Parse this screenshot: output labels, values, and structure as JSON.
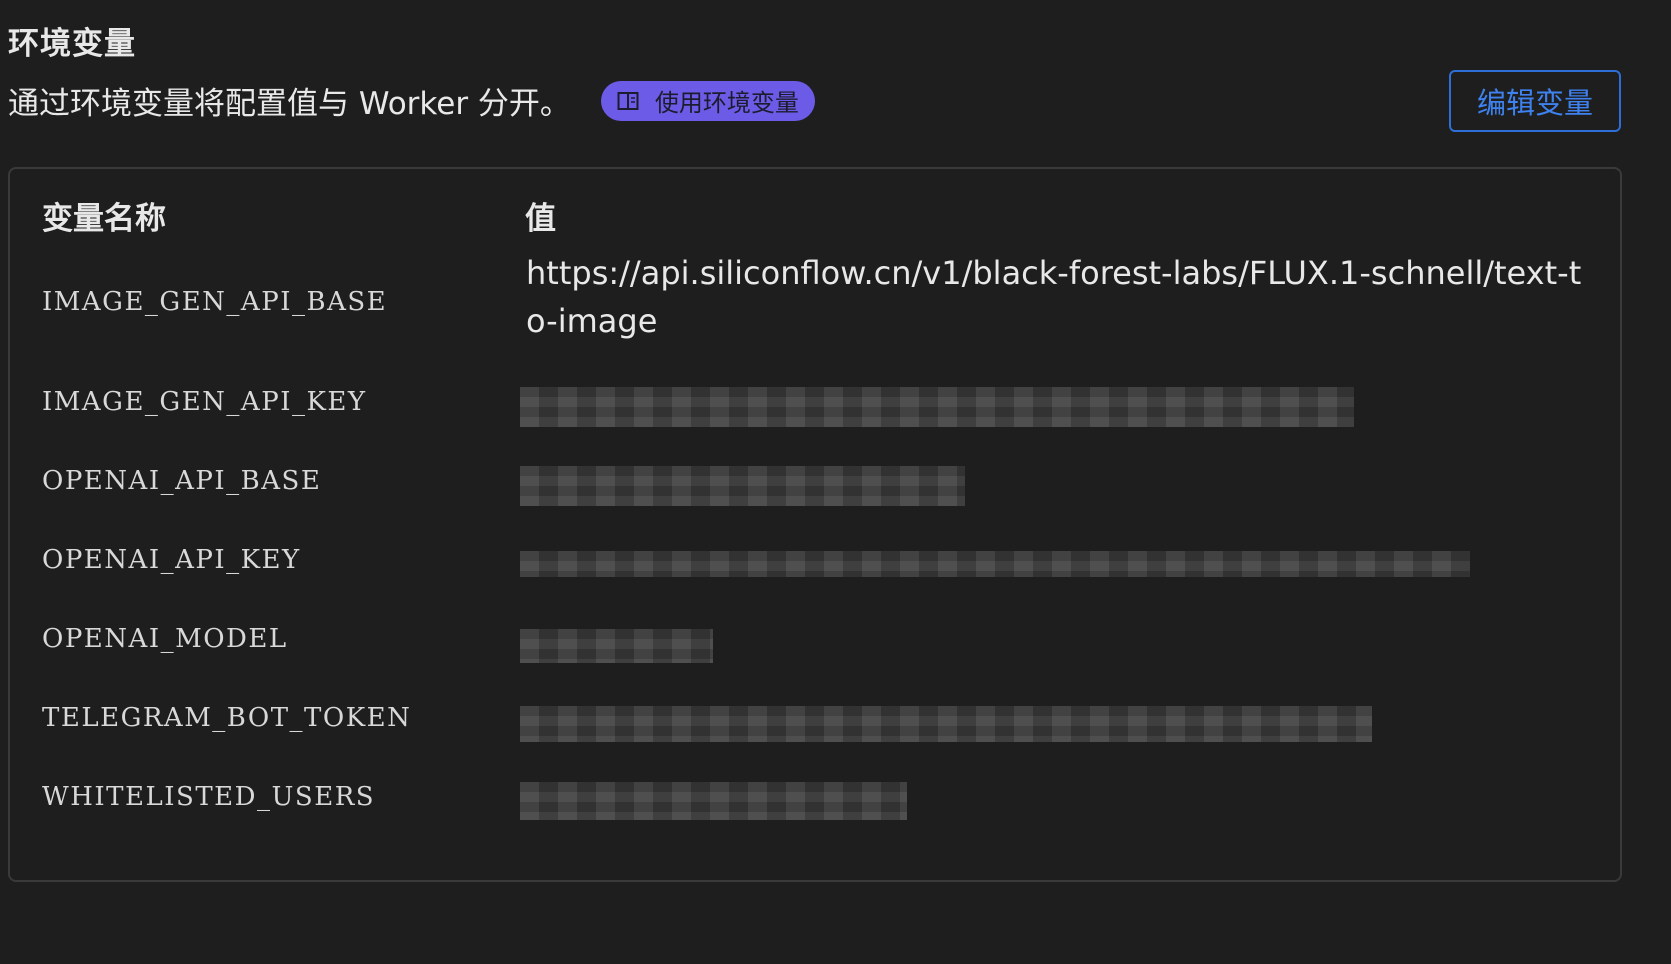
{
  "section": {
    "title": "环境变量",
    "description": "通过环境变量将配置值与 Worker 分开。",
    "doc_link_label": "使用环境变量",
    "edit_button_label": "编辑变量"
  },
  "table": {
    "headers": {
      "name": "变量名称",
      "value": "值"
    },
    "rows": [
      {
        "name": "IMAGE_GEN_API_BASE",
        "value": "https://api.siliconflow.cn/v1/black-forest-labs/FLUX.1-schnell/text-to-image",
        "redacted": false
      },
      {
        "name": "IMAGE_GEN_API_KEY",
        "value": "",
        "redacted": true
      },
      {
        "name": "OPENAI_API_BASE",
        "value": "",
        "redacted": true
      },
      {
        "name": "OPENAI_API_KEY",
        "value": "",
        "redacted": true
      },
      {
        "name": "OPENAI_MODEL",
        "value": "",
        "redacted": true
      },
      {
        "name": "TELEGRAM_BOT_TOKEN",
        "value": "",
        "redacted": true
      },
      {
        "name": "WHITELISTED_USERS",
        "value": "",
        "redacted": true
      }
    ]
  },
  "icons": {
    "doc_link": "book-icon"
  },
  "colors": {
    "background": "#1e1e1e",
    "accent_pill": "#6c5be6",
    "button_border": "#2d6fd6",
    "button_text": "#3e82f0",
    "card_border": "#3a3a3a"
  }
}
